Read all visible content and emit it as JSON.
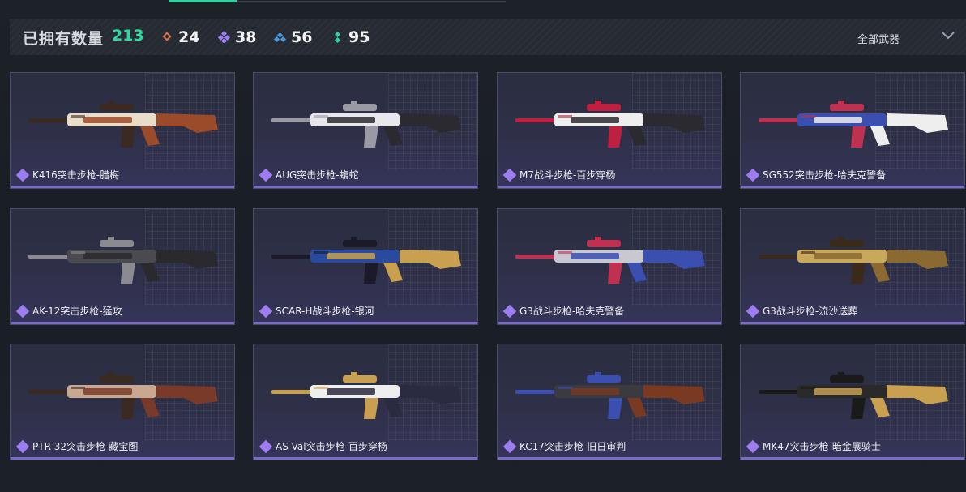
{
  "header": {
    "owned_label": "已拥有数量",
    "owned_total": "213",
    "stats": [
      {
        "icon": "orange-rarity-icon",
        "color": "#d9774a",
        "value": "24"
      },
      {
        "icon": "purple-rarity-icon",
        "color": "#9d7df0",
        "value": "38"
      },
      {
        "icon": "blue-rarity-icon",
        "color": "#4a9be0",
        "value": "56"
      },
      {
        "icon": "green-rarity-icon",
        "color": "#2fd3a0",
        "value": "95"
      }
    ],
    "filter_label": "全部武器"
  },
  "weapons": [
    {
      "name": "K416突击步枪-腊梅",
      "rarity": "purple",
      "palette": [
        "#e9dcc8",
        "#9b4a2a",
        "#3a2a22"
      ]
    },
    {
      "name": "AUG突击步枪-蝮蛇",
      "rarity": "purple",
      "palette": [
        "#e8e8ec",
        "#2a2a30",
        "#9a9aa4"
      ]
    },
    {
      "name": "M7战斗步枪-百步穿杨",
      "rarity": "purple",
      "palette": [
        "#eeeeee",
        "#2a2a30",
        "#c02040"
      ]
    },
    {
      "name": "SG552突击步枪-哈夫克警备",
      "rarity": "purple",
      "palette": [
        "#3a4fb0",
        "#eeeeee",
        "#c03050"
      ]
    },
    {
      "name": "AK-12突击步枪-猛攻",
      "rarity": "purple",
      "palette": [
        "#4a4a50",
        "#2a2a2e",
        "#8a8a90"
      ]
    },
    {
      "name": "SCAR-H战斗步枪-银河",
      "rarity": "purple",
      "palette": [
        "#2a4aa0",
        "#c8a050",
        "#1a1a2a"
      ]
    },
    {
      "name": "G3战斗步枪-哈夫克警备",
      "rarity": "purple",
      "palette": [
        "#c8c8d0",
        "#3a4fb0",
        "#c03050"
      ]
    },
    {
      "name": "G3战斗步枪-流沙送葬",
      "rarity": "purple",
      "palette": [
        "#c8a85a",
        "#8a6a30",
        "#3a2a1a"
      ]
    },
    {
      "name": "PTR-32突击步枪-藏宝图",
      "rarity": "purple",
      "palette": [
        "#c8a890",
        "#7a3a2a",
        "#3a2a22"
      ]
    },
    {
      "name": "AS Val突击步枪-百步穿杨",
      "rarity": "purple",
      "palette": [
        "#eeeeee",
        "#2a2a40",
        "#c8a050"
      ]
    },
    {
      "name": "KC17突击步枪-旧日审判",
      "rarity": "purple",
      "palette": [
        "#3a3a40",
        "#7a3a22",
        "#3a4fb0"
      ]
    },
    {
      "name": "MK47突击步枪-暗金展骑士",
      "rarity": "purple",
      "palette": [
        "#2a2a2a",
        "#c8a050",
        "#1a1a1a"
      ]
    }
  ]
}
